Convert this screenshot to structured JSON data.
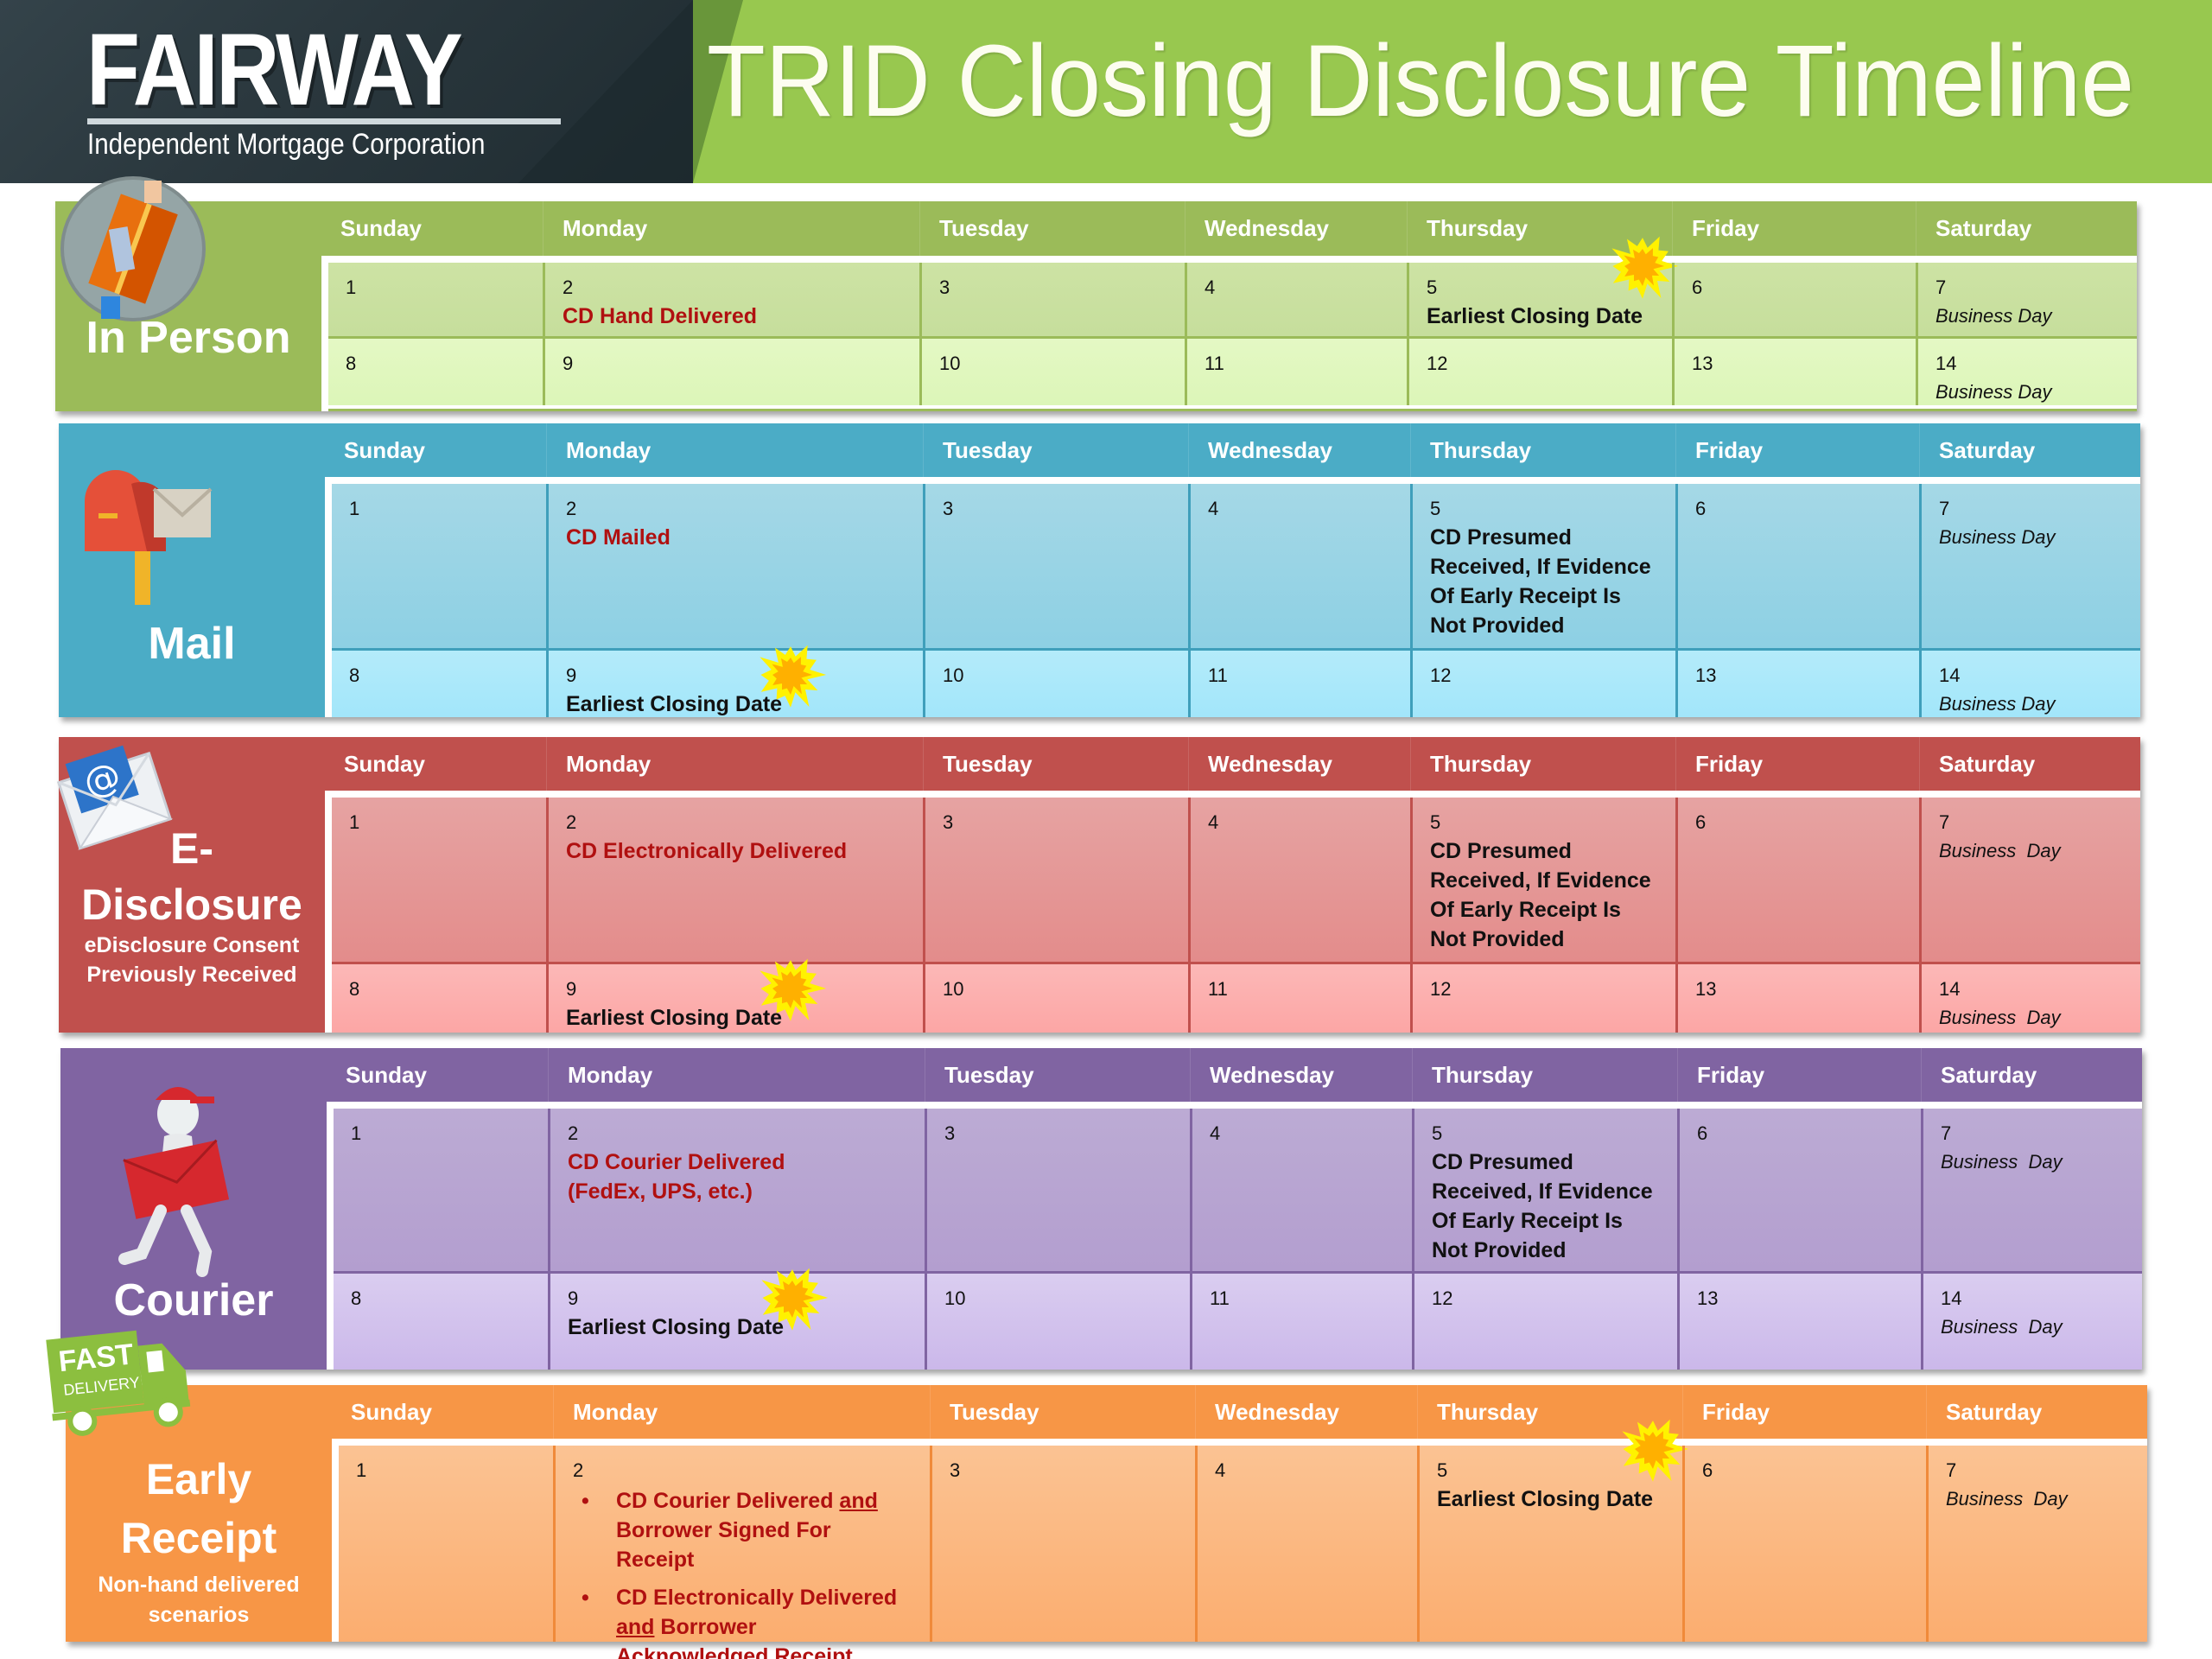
{
  "header": {
    "logo_name": "FAIRWAY",
    "logo_tagline": "Independent Mortgage Corporation",
    "title": "TRID Closing Disclosure Timeline"
  },
  "weekdays": [
    "Sunday",
    "Monday",
    "Tuesday",
    "Wednesday",
    "Thursday",
    "Friday",
    "Saturday"
  ],
  "legend": {
    "closing_marker_icon": "starburst-icon",
    "closing_marker_colors": {
      "outer": "#FFF200",
      "inner": "#FFB000"
    }
  },
  "sections": [
    {
      "id": "in-person",
      "label": "In Person",
      "sublabel": "",
      "icon": "hand-delivery-package-icon",
      "color": "#9BBB59",
      "weeks": [
        [
          {
            "day": "1"
          },
          {
            "day": "2",
            "note": "CD Hand Delivered",
            "style": "red"
          },
          {
            "day": "3"
          },
          {
            "day": "4"
          },
          {
            "day": "5",
            "note": "Earliest Closing Date",
            "style": "black",
            "marker": true
          },
          {
            "day": "6"
          },
          {
            "day": "7",
            "note": "Business Day",
            "style": "italic"
          }
        ],
        [
          {
            "day": "8"
          },
          {
            "day": "9"
          },
          {
            "day": "10"
          },
          {
            "day": "11"
          },
          {
            "day": "12"
          },
          {
            "day": "13"
          },
          {
            "day": "14",
            "note": "Business Day",
            "style": "italic"
          }
        ]
      ]
    },
    {
      "id": "mail",
      "label": "Mail",
      "sublabel": "",
      "icon": "mailbox-icon",
      "color": "#4BACC6",
      "weeks": [
        [
          {
            "day": "1"
          },
          {
            "day": "2",
            "note": "CD Mailed",
            "style": "red"
          },
          {
            "day": "3"
          },
          {
            "day": "4"
          },
          {
            "day": "5",
            "note": "CD Presumed Received, If Evidence Of Early Receipt Is Not Provided",
            "style": "black"
          },
          {
            "day": "6"
          },
          {
            "day": "7",
            "note": "Business Day",
            "style": "italic"
          }
        ],
        [
          {
            "day": "8"
          },
          {
            "day": "9",
            "note": "Earliest Closing Date",
            "style": "black",
            "marker": true
          },
          {
            "day": "10"
          },
          {
            "day": "11"
          },
          {
            "day": "12"
          },
          {
            "day": "13"
          },
          {
            "day": "14",
            "note": "Business Day",
            "style": "italic"
          }
        ]
      ]
    },
    {
      "id": "e-disclosure",
      "label": "E-Disclosure",
      "label_line1": "E-",
      "label_line2": "Disclosure",
      "sublabel_line1": "eDisclosure Consent",
      "sublabel_line2": "Previously Received",
      "icon": "email-envelope-icon",
      "color": "#C0504D",
      "weeks": [
        [
          {
            "day": "1"
          },
          {
            "day": "2",
            "note": "CD Electronically Delivered",
            "style": "red"
          },
          {
            "day": "3"
          },
          {
            "day": "4"
          },
          {
            "day": "5",
            "note": "CD Presumed Received, If Evidence Of Early Receipt Is Not Provided",
            "style": "black"
          },
          {
            "day": "6"
          },
          {
            "day": "7",
            "note": "Business  Day",
            "style": "italic"
          }
        ],
        [
          {
            "day": "8"
          },
          {
            "day": "9",
            "note": "Earliest Closing Date",
            "style": "black",
            "marker": true
          },
          {
            "day": "10"
          },
          {
            "day": "11"
          },
          {
            "day": "12"
          },
          {
            "day": "13"
          },
          {
            "day": "14",
            "note": "Business  Day",
            "style": "italic"
          }
        ]
      ]
    },
    {
      "id": "courier",
      "label": "Courier",
      "sublabel": "",
      "icon": "courier-runner-icon",
      "color": "#8064A2",
      "weeks": [
        [
          {
            "day": "1"
          },
          {
            "day": "2",
            "note": "CD Courier Delivered",
            "note2": "(FedEx, UPS, etc.)",
            "style": "red"
          },
          {
            "day": "3"
          },
          {
            "day": "4"
          },
          {
            "day": "5",
            "note": "CD Presumed Received, If Evidence Of Early Receipt Is Not Provided",
            "style": "black"
          },
          {
            "day": "6"
          },
          {
            "day": "7",
            "note": "Business  Day",
            "style": "italic"
          }
        ],
        [
          {
            "day": "8"
          },
          {
            "day": "9",
            "note": "Earliest Closing Date",
            "style": "black",
            "marker": true
          },
          {
            "day": "10"
          },
          {
            "day": "11"
          },
          {
            "day": "12"
          },
          {
            "day": "13"
          },
          {
            "day": "14",
            "note": "Business  Day",
            "style": "italic"
          }
        ]
      ]
    },
    {
      "id": "early-receipt",
      "label": "Early Receipt",
      "label_line1": "Early",
      "label_line2": "Receipt",
      "sublabel_line1": "Non-hand delivered",
      "sublabel_line2": "scenarios",
      "icon": "fast-delivery-truck-icon",
      "icon_text_1": "FAST",
      "icon_text_2": "DELIVERY",
      "color": "#F79646",
      "weeks": [
        [
          {
            "day": "1"
          },
          {
            "day": "2",
            "bullets": [
              {
                "a": "CD Courier Delivered ",
                "u": "and",
                "b": " Borrower Signed For Receipt"
              },
              {
                "a": "CD Electronically Delivered ",
                "u": "and",
                "b": " Borrower Acknowledged Receipt"
              }
            ]
          },
          {
            "day": "3"
          },
          {
            "day": "4"
          },
          {
            "day": "5",
            "note": "Earliest Closing Date",
            "style": "black",
            "marker": true
          },
          {
            "day": "6"
          },
          {
            "day": "7",
            "note": "Business  Day",
            "style": "italic"
          }
        ]
      ]
    }
  ]
}
